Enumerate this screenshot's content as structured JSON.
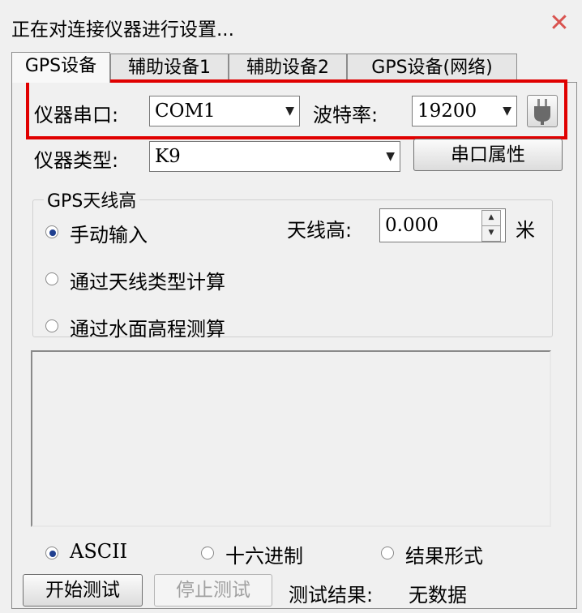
{
  "window": {
    "title": "正在对连接仪器进行设置...",
    "close_icon": "close-icon",
    "close_color": "#d9534f"
  },
  "tabs": [
    {
      "label": "GPS设备",
      "active": true
    },
    {
      "label": "辅助设备1",
      "active": false
    },
    {
      "label": "辅助设备2",
      "active": false
    },
    {
      "label": "GPS设备(网络)",
      "active": false
    }
  ],
  "serial": {
    "port_label": "仪器串口:",
    "port_value": "COM1",
    "baud_label": "波特率:",
    "baud_value": "19200",
    "connect_icon": "plug-icon",
    "highlight_color": "#e00000"
  },
  "device": {
    "type_label": "仪器类型:",
    "type_value": "K9",
    "serial_props_button": "串口属性"
  },
  "antenna": {
    "group_title": "GPS天线高",
    "options": [
      "手动输入",
      "通过天线类型计算",
      "通过水面高程测算"
    ],
    "selected_index": 0,
    "height_label": "天线高:",
    "height_value": "0.000",
    "height_unit": "米"
  },
  "format": {
    "options": [
      "ASCII",
      "十六进制",
      "结果形式"
    ],
    "selected_index": 0
  },
  "test": {
    "start_button": "开始测试",
    "stop_button": "停止测试",
    "result_label": "测试结果:",
    "result_value": "无数据"
  }
}
